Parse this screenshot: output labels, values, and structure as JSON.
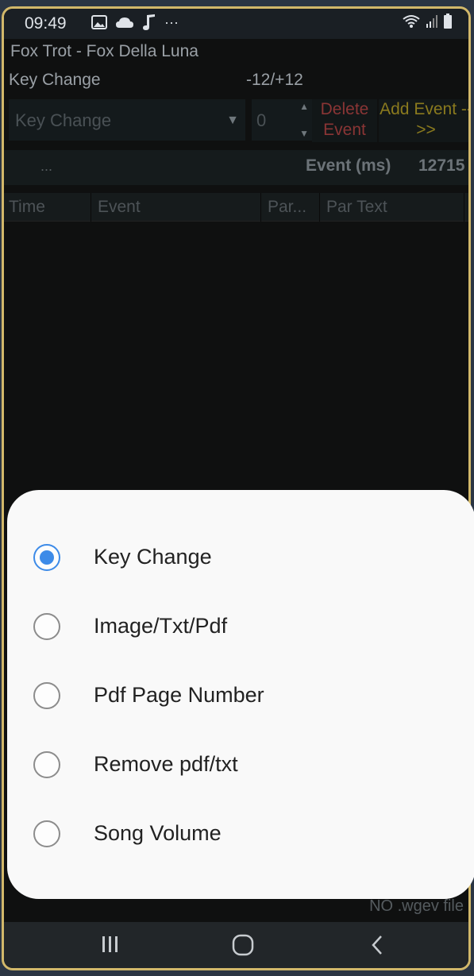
{
  "status_bar": {
    "time": "09:49",
    "more": "···",
    "icons": [
      "image-icon",
      "cloud-icon",
      "music-note-icon",
      "wifi-icon",
      "signal-icon",
      "battery-icon"
    ]
  },
  "app": {
    "song_title": "Fox Trot - Fox Della Luna",
    "key_change_label": "Key Change",
    "range_label": "-12/+12",
    "event_type_select": "Key Change",
    "param_value": "0",
    "delete_button": "Delete Event",
    "add_button": "Add Event -->>",
    "dots": "...",
    "event_ms_label": "Event (ms)",
    "event_ms_value": "12715",
    "table_headers": [
      "Time",
      "Event",
      "Par...",
      "Par Text"
    ],
    "no_file_text": "NO .wgev file"
  },
  "sheet": {
    "options": [
      {
        "label": "Key Change",
        "selected": true
      },
      {
        "label": "Image/Txt/Pdf",
        "selected": false
      },
      {
        "label": "Pdf Page Number",
        "selected": false
      },
      {
        "label": "Remove pdf/txt",
        "selected": false
      },
      {
        "label": "Song Volume",
        "selected": false
      }
    ]
  },
  "colors": {
    "accent": "#3d8be8",
    "delete": "#8a3535",
    "add": "#8a7a1e",
    "frame": "#d2b86a"
  }
}
